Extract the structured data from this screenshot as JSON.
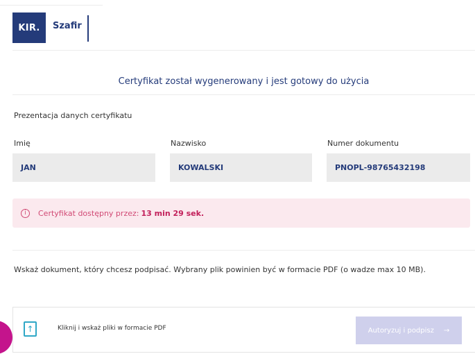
{
  "header": {
    "logo_kir": "KIR.",
    "logo_product": "Szafir"
  },
  "main": {
    "title": "Certyfikat został wygenerowany i jest gotowy do użycia",
    "section_label": "Prezentacja danych certyfikatu",
    "fields": [
      {
        "label": "Imię",
        "value": "JAN"
      },
      {
        "label": "Nazwisko",
        "value": "KOWALSKI"
      },
      {
        "label": "Numer dokumentu",
        "value": "PNOPL-98765432198"
      }
    ],
    "alert": {
      "icon": "info-icon",
      "text": "Certyfikat dostępny przez:",
      "time": "13 min 29 sek."
    },
    "instruction": "Wskaż dokument, który chcesz podpisać. Wybrany plik powinien być w formacie PDF (o wadze max 10 MB).",
    "upload": {
      "icon": "upload-file-icon",
      "text": "Kliknij i wskaż pliki w formacie PDF",
      "button_label": "Autoryzuj i podpisz",
      "button_icon": "arrow-right-icon"
    }
  },
  "colors": {
    "brand": "#243b7a",
    "alert_bg": "#fbe9ee",
    "alert_text": "#d14a75",
    "button_disabled": "#cfd0ec",
    "accent": "#2fa7c6"
  }
}
